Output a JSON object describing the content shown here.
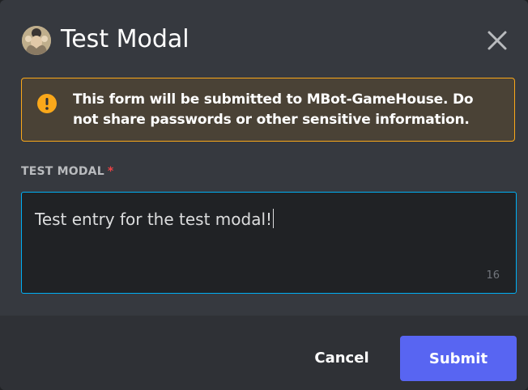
{
  "modal": {
    "title": "Test Modal",
    "avatar_icon": "bot-avatar",
    "close_icon": "close-icon"
  },
  "warning": {
    "icon": "exclamation-icon",
    "text_before": "This form will be submitted to ",
    "bot_name": "MBot-GameHouse",
    "text_after": ". Do not share passwords or other sensitive information.",
    "accent_color": "#faa81a"
  },
  "field": {
    "label": "TEST MODAL",
    "required_mark": "*",
    "value": "Test entry for the test modal!",
    "char_count": "16"
  },
  "footer": {
    "cancel_label": "Cancel",
    "submit_label": "Submit",
    "submit_color": "#5865f2"
  }
}
